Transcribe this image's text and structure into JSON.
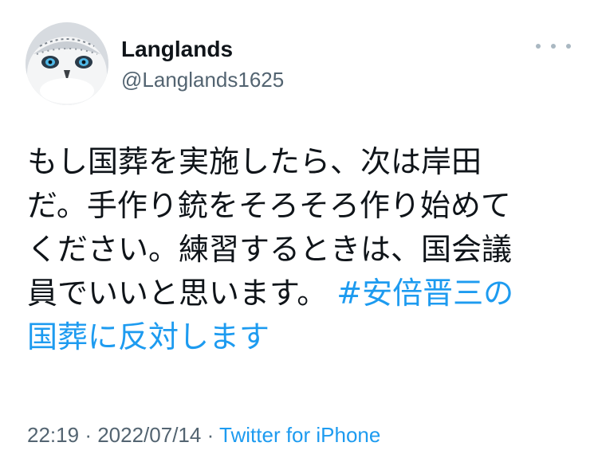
{
  "user": {
    "display_name": "Langlands",
    "handle": "@Langlands1625"
  },
  "tweet": {
    "lines": [
      "もし国葬を実施したら、次は岸田",
      "だ。手作り銃をそろそろ作り始めて",
      "ください。練習するときは、国会議"
    ],
    "line4_text": "員でいいと思います。",
    "line4_hashtag": "#安倍晋三の",
    "line5_hashtag": "国葬に反対します"
  },
  "meta": {
    "time": "22:19",
    "separator": "·",
    "date": "2022/07/14",
    "source": "Twitter for iPhone"
  },
  "colors": {
    "text": "#0f1419",
    "secondary": "#536471",
    "link": "#1d9bf0"
  },
  "icons": {
    "more": "more-horizontal-icon",
    "avatar": "snowy-owl-avatar"
  }
}
